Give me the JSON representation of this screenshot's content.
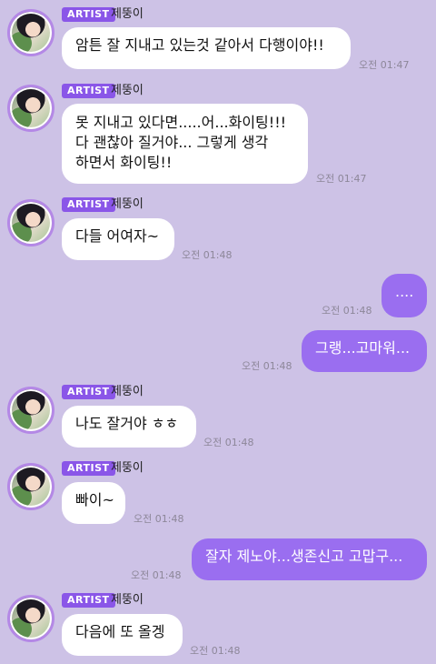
{
  "sender_name": "제뚱이",
  "badge": "ARTIST",
  "messages": [
    {
      "text": "암튼 잘 지내고 있는것 같아서 다행이야!!",
      "time": "오전 01:47"
    },
    {
      "text1": "못 지내고 있다면.....어...화이팅!!!",
      "text2": "다 괜찮아 질거야... 그렇게 생각",
      "text3": "하면서 화이팅!!",
      "time": "오전 01:47"
    },
    {
      "text": "다들 어여자~",
      "time": "오전 01:48"
    },
    {
      "text": "....",
      "time": "오전 01:48"
    },
    {
      "text": "그랭...고마워...",
      "time": "오전 01:48"
    },
    {
      "text": "나도 잘거야 ㅎㅎ",
      "time": "오전 01:48"
    },
    {
      "text": "빠이~",
      "time": "오전 01:48"
    },
    {
      "text": "잘자 제노야...생존신고 고맙구...",
      "time": "오전 01:48"
    },
    {
      "text": "다음에 또 올겡",
      "time": "오전 01:48"
    }
  ]
}
